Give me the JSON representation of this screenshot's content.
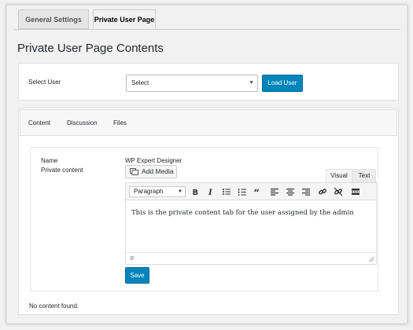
{
  "tabs": [
    "General Settings",
    "Private User Page"
  ],
  "page_title": "Private User Page Contents",
  "select_user": {
    "label": "Select User",
    "value": "Select",
    "button_label": "Load User"
  },
  "subtabs": [
    "Content",
    "Discussion",
    "Files"
  ],
  "content_form": {
    "name_label": "Name",
    "name_value": "WP Expert Designer",
    "private_content_label": "Private content",
    "add_media_label": "Add Media",
    "mode_tabs": [
      "Visual",
      "Text"
    ],
    "format_value": "Paragraph",
    "editor_text": "This is the private content tab for the user assigned by the admin",
    "path_label": "p",
    "save_label": "Save"
  },
  "no_content_text": "No content found.",
  "colors": {
    "primary_button": "#0085ba",
    "background": "#f1f1f1"
  }
}
